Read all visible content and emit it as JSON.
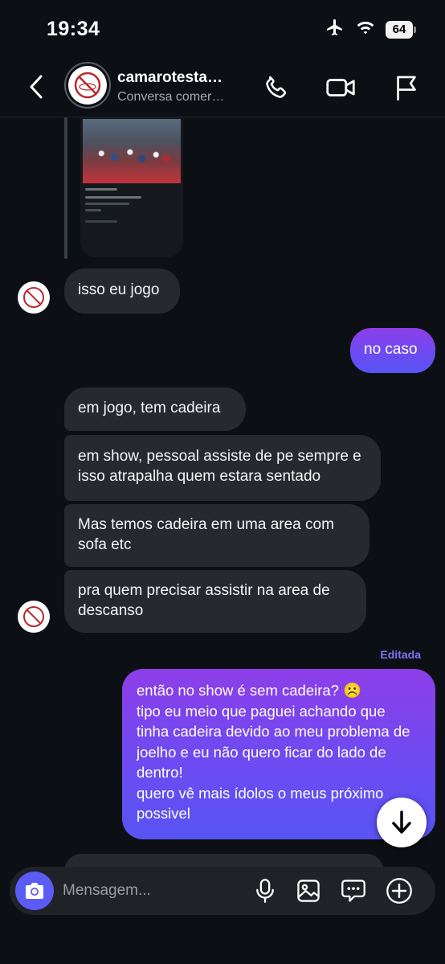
{
  "status_bar": {
    "time": "19:34",
    "battery": "64",
    "icons": [
      "airplane-icon",
      "wifi-icon",
      "battery-icon"
    ]
  },
  "header": {
    "contact_name": "camarotesta…",
    "contact_status": "Conversa comer…",
    "icons": [
      "back-chevron-icon",
      "phone-icon",
      "video-camera-icon",
      "flag-icon"
    ]
  },
  "messages": [
    {
      "from": "them",
      "text": "isso eu jogo"
    },
    {
      "from": "me",
      "text": "no caso"
    },
    {
      "from": "them",
      "text": "em jogo, tem cadeira"
    },
    {
      "from": "them",
      "text": "em show, pessoal assiste de pe sempre e isso atrapalha quem estara sentado"
    },
    {
      "from": "them",
      "text": "Mas temos cadeira em uma area com sofa etc"
    },
    {
      "from": "them",
      "text": "pra quem precisar assistir na area de descanso"
    },
    {
      "from": "me",
      "edited_label": "Editada",
      "text": "então no show é sem cadeira? ☹️\ntipo eu meio que paguei achando que tinha cadeira devido ao meu problema de joelho e eu não quero ficar do lado de dentro!\nquero vê mais ídolos o meus próximo possivel"
    }
  ],
  "composer": {
    "placeholder": "Mensagem...",
    "icons": [
      "camera-icon",
      "microphone-icon",
      "gallery-icon",
      "sticker-chat-icon",
      "plus-icon"
    ]
  },
  "colors": {
    "background": "#0c1014",
    "incoming_bubble": "#26292e",
    "outgoing_gradient_start": "#8d3ee8",
    "outgoing_gradient_end": "#5754f3",
    "accent": "#5b5cf6",
    "edited_label": "#7b74f5"
  }
}
